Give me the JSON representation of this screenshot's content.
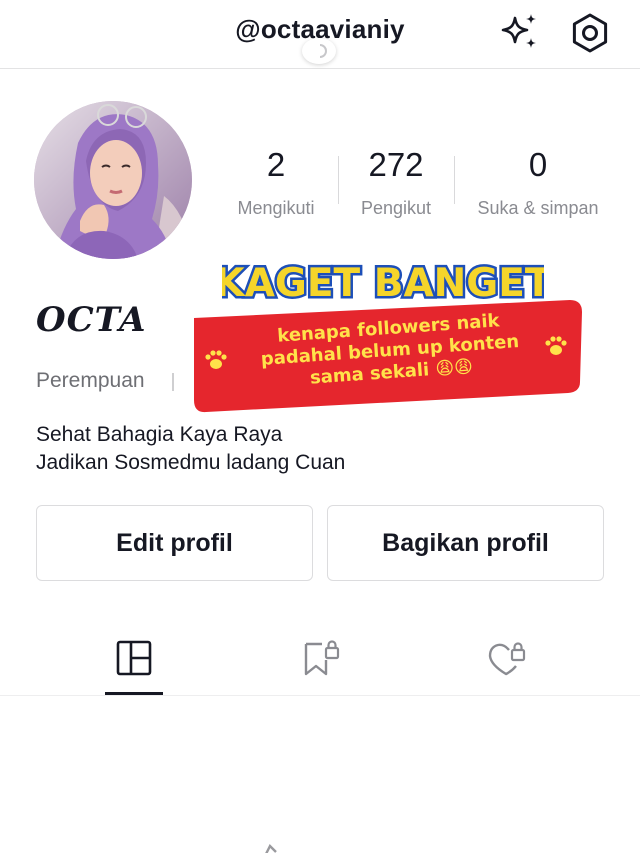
{
  "header": {
    "username": "@octaavianiy"
  },
  "profile": {
    "display_name": "OCTA",
    "gender": "Perempuan",
    "bio_lines": [
      "Sehat Bahagia Kaya Raya",
      "Jadikan Sosmedmu ladang Cuan"
    ]
  },
  "stats": [
    {
      "value": "2",
      "label": "Mengikuti"
    },
    {
      "value": "272",
      "label": "Pengikut"
    },
    {
      "value": "0",
      "label": "Suka & simpan"
    }
  ],
  "buttons": {
    "edit": "Edit profil",
    "share": "Bagikan profil"
  },
  "tabs": [
    {
      "icon": "grid-icon",
      "active": true
    },
    {
      "icon": "bookmark-lock-icon",
      "active": false
    },
    {
      "icon": "heart-lock-icon",
      "active": false
    }
  ],
  "sticker": {
    "title": "KAGET BANGET",
    "lines": [
      "kenapa followers naik",
      "padahal belum up konten",
      "sama sekali 😩😩"
    ],
    "colors": {
      "title_fill": "#f5d52a",
      "title_stroke": "#1d4fb8",
      "banner": "#e5262d",
      "text": "#ffe24a"
    }
  }
}
